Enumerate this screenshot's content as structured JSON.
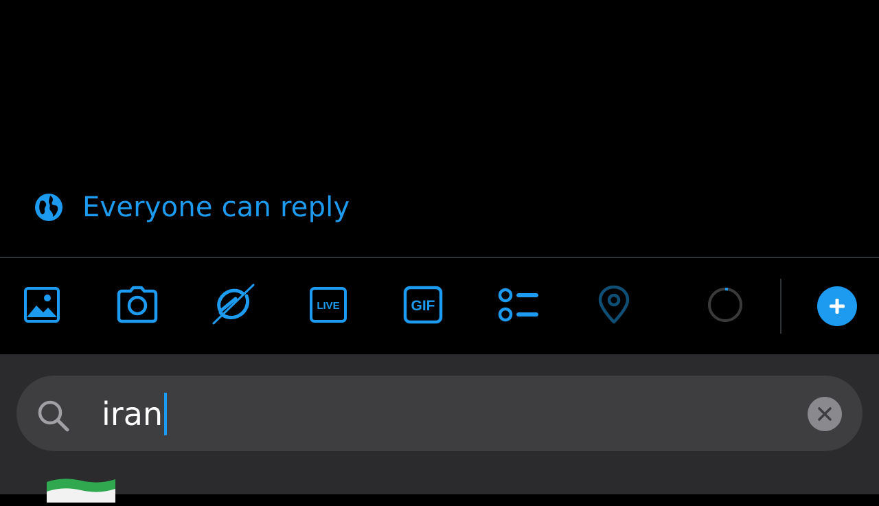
{
  "reply_setting": {
    "label": "Everyone can reply",
    "icon": "globe-icon"
  },
  "toolbar": {
    "items": [
      {
        "name": "image-icon"
      },
      {
        "name": "camera-icon"
      },
      {
        "name": "grok-icon"
      },
      {
        "name": "live-icon",
        "text": "LIVE"
      },
      {
        "name": "gif-icon",
        "text": "GIF"
      },
      {
        "name": "poll-icon"
      },
      {
        "name": "location-icon"
      },
      {
        "name": "character-counter-icon"
      }
    ],
    "add_button_icon": "plus-icon"
  },
  "emoji_search": {
    "query": "iran",
    "search_icon": "search-icon",
    "clear_icon": "clear-icon",
    "results": [
      {
        "name": "iran-flag-emoji"
      }
    ]
  },
  "colors": {
    "accent": "#1d9bf0",
    "background": "#000000",
    "panel": "#2b2b2d",
    "search_field": "#3e3e41"
  }
}
